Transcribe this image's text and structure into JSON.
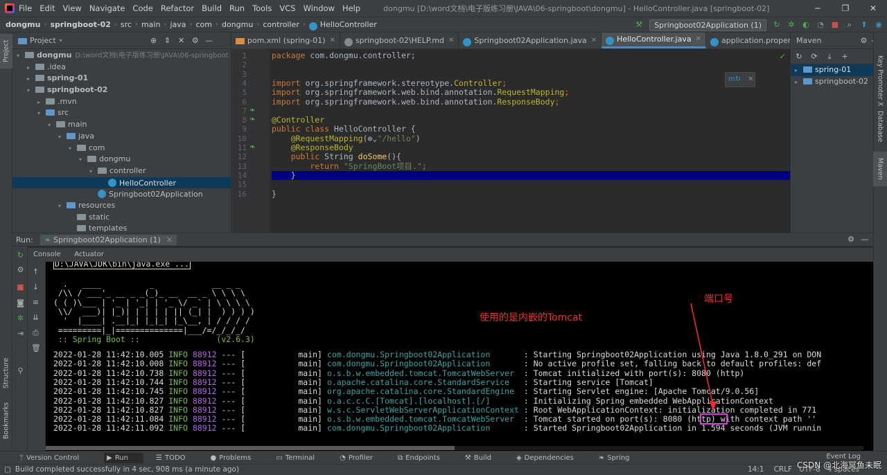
{
  "titlebar": {
    "menu": [
      "File",
      "Edit",
      "View",
      "Navigate",
      "Code",
      "Refactor",
      "Build",
      "Run",
      "Tools",
      "VCS",
      "Window",
      "Help"
    ],
    "title": "dongmu [D:\\word文档\\电子版练习册\\JAVA\\06-springboot\\dongmu] - HelloController.java [springboot-02]"
  },
  "breadcrumb": [
    "dongmu",
    "springboot-02",
    "src",
    "main",
    "java",
    "com",
    "dongmu",
    "controller",
    "HelloController"
  ],
  "run_config": "Springboot02Application (1)",
  "project": {
    "header": "Project",
    "items": [
      {
        "label": "dongmu",
        "extra": "D:\\word文档\\电子版练习册\\JAVA\\06-springboot",
        "depth": 0,
        "arrow": "▾",
        "bold": true
      },
      {
        "label": ".idea",
        "depth": 1,
        "arrow": "▸"
      },
      {
        "label": "spring-01",
        "depth": 1,
        "arrow": "▸",
        "bold": true
      },
      {
        "label": "springboot-02",
        "depth": 1,
        "arrow": "▾",
        "bold": true
      },
      {
        "label": ".mvn",
        "depth": 2,
        "arrow": "▸"
      },
      {
        "label": "src",
        "depth": 2,
        "arrow": "▾"
      },
      {
        "label": "main",
        "depth": 3,
        "arrow": "▾"
      },
      {
        "label": "java",
        "depth": 4,
        "arrow": "▾"
      },
      {
        "label": "com",
        "depth": 5,
        "arrow": "▾"
      },
      {
        "label": "dongmu",
        "depth": 6,
        "arrow": "▾"
      },
      {
        "label": "controller",
        "depth": 7,
        "arrow": "▾"
      },
      {
        "label": "HelloController",
        "depth": 8,
        "arrow": "",
        "selected": true,
        "cls": true
      },
      {
        "label": "Springboot02Application",
        "depth": 7,
        "arrow": "",
        "cls": true
      },
      {
        "label": "resources",
        "depth": 4,
        "arrow": "▾"
      },
      {
        "label": "static",
        "depth": 5,
        "arrow": ""
      },
      {
        "label": "templates",
        "depth": 5,
        "arrow": ""
      }
    ]
  },
  "editor_tabs": [
    {
      "label": "pom.xml (spring-01)"
    },
    {
      "label": "springboot-02\\HELP.md"
    },
    {
      "label": "Springboot02Application.java"
    },
    {
      "label": "HelloController.java",
      "active": true
    },
    {
      "label": "application.propertie"
    }
  ],
  "code_lines": [
    [
      {
        "t": "package ",
        "c": "kw"
      },
      {
        "t": "com.dongmu.controller;",
        "c": ""
      }
    ],
    [],
    [],
    [
      {
        "t": "import ",
        "c": "kw"
      },
      {
        "t": "org.springframework.stereotype.",
        "c": ""
      },
      {
        "t": "Controller",
        "c": "an"
      },
      {
        "t": ";",
        "c": "kw"
      }
    ],
    [
      {
        "t": "import ",
        "c": "kw"
      },
      {
        "t": "org.springframework.web.bind.annotation.",
        "c": ""
      },
      {
        "t": "RequestMapping",
        "c": "an"
      },
      {
        "t": ";",
        "c": "kw"
      }
    ],
    [
      {
        "t": "import ",
        "c": "kw"
      },
      {
        "t": "org.springframework.web.bind.annotation.",
        "c": ""
      },
      {
        "t": "ResponseBody",
        "c": "an"
      },
      {
        "t": ";",
        "c": "kw"
      }
    ],
    [],
    [
      {
        "t": "@Controller",
        "c": "an"
      }
    ],
    [
      {
        "t": "public class ",
        "c": "kw"
      },
      {
        "t": "HelloController {",
        "c": ""
      }
    ],
    [
      {
        "t": "    @RequestMapping",
        "c": "an"
      },
      {
        "t": "(",
        "c": ""
      },
      {
        "t": "⊕⌄",
        "c": ""
      },
      {
        "t": "\"/hello\"",
        "c": "st"
      },
      {
        "t": ")",
        "c": ""
      }
    ],
    [
      {
        "t": "    @ResponseBody",
        "c": "an"
      }
    ],
    [
      {
        "t": "    public ",
        "c": "kw"
      },
      {
        "t": "String ",
        "c": ""
      },
      {
        "t": "doSome",
        "c": "fn"
      },
      {
        "t": "(){",
        "c": ""
      }
    ],
    [
      {
        "t": "        return ",
        "c": "kw"
      },
      {
        "t": "\"SpringBoot项目.\"",
        "c": "st"
      },
      {
        "t": ";",
        "c": "kw"
      }
    ],
    [
      {
        "t": "    }",
        "c": ""
      }
    ],
    [],
    [
      {
        "t": "}",
        "c": ""
      }
    ],
    []
  ],
  "maven": {
    "header": "Maven",
    "items": [
      "spring-01",
      "springboot-02"
    ]
  },
  "run": {
    "label": "Run:",
    "config": "Springboot02Application (1)",
    "subtabs": [
      "Console",
      "Actuator"
    ]
  },
  "console": {
    "cmd": "D:\\JAVA\\JDK\\bin\\java.exe ...",
    "banner": [
      "  .   ____          _            __ _ _",
      " /\\\\ / ___'_ __ _ _(_)_ __  __ _ \\ \\ \\ \\",
      "( ( )\\___ | '_ | '_| | '_ \\/ _` | \\ \\ \\ \\",
      " \\\\/  ___)| |_)| | | | | || (_| |  ) ) ) )",
      "  '  |____| .__|_| |_|_| |_\\__, | / / / /",
      " =========|_|==============|___/=/_/_/_/"
    ],
    "banner_footer": " :: Spring Boot ::                (v2.6.3)",
    "logs": [
      {
        "time": "2022-01-28 11:42:10.005",
        "level": "INFO",
        "pid": "88912",
        "sep": "--- [",
        "thread": "           main]",
        "logger": "com.dongmu.Springboot02Application      ",
        "msg": " : Starting Springboot02Application using Java 1.8.0_291 on DON"
      },
      {
        "time": "2022-01-28 11:42:10.008",
        "level": "INFO",
        "pid": "88912",
        "sep": "--- [",
        "thread": "           main]",
        "logger": "com.dongmu.Springboot02Application      ",
        "msg": " : No active profile set, falling back to default profiles: def"
      },
      {
        "time": "2022-01-28 11:42:10.738",
        "level": "INFO",
        "pid": "88912",
        "sep": "--- [",
        "thread": "           main]",
        "logger": "o.s.b.w.embedded.tomcat.TomcatWebServer ",
        "msg": " : Tomcat initialized with port(s): 8080 (http)"
      },
      {
        "time": "2022-01-28 11:42:10.744",
        "level": "INFO",
        "pid": "88912",
        "sep": "--- [",
        "thread": "           main]",
        "logger": "o.apache.catalina.core.StandardService  ",
        "msg": " : Starting service [Tomcat]"
      },
      {
        "time": "2022-01-28 11:42:10.745",
        "level": "INFO",
        "pid": "88912",
        "sep": "--- [",
        "thread": "           main]",
        "logger": "org.apache.catalina.core.StandardEngine ",
        "msg": " : Starting Servlet engine: [Apache Tomcat/9.0.56]"
      },
      {
        "time": "2022-01-28 11:42:10.827",
        "level": "INFO",
        "pid": "88912",
        "sep": "--- [",
        "thread": "           main]",
        "logger": "o.a.c.c.C.[Tomcat].[localhost].[/]      ",
        "msg": " : Initializing Spring embedded WebApplicationContext"
      },
      {
        "time": "2022-01-28 11:42:10.827",
        "level": "INFO",
        "pid": "88912",
        "sep": "--- [",
        "thread": "           main]",
        "logger": "w.s.c.ServletWebServerApplicationContext",
        "msg": " : Root WebApplicationContext: initialization completed in 771"
      },
      {
        "time": "2022-01-28 11:42:11.084",
        "level": "INFO",
        "pid": "88912",
        "sep": "--- [",
        "thread": "           main]",
        "logger": "o.s.b.w.embedded.tomcat.TomcatWebServer ",
        "msg": " : Tomcat started on port(s): 8080 (http) with context path ''"
      },
      {
        "time": "2022-01-28 11:42:11.092",
        "level": "INFO",
        "pid": "88912",
        "sep": "--- [",
        "thread": "           main]",
        "logger": "com.dongmu.Springboot02Application      ",
        "msg": " : Started Springboot02Application in 1.594 seconds (JVM runnin"
      }
    ],
    "annotation_tomcat": "使用的是内嵌的Tomcat",
    "annotation_port": "端口号"
  },
  "bottom_tabs": [
    "Version Control",
    "Run",
    "TODO",
    "Problems",
    "Terminal",
    "Profiler",
    "Endpoints",
    "Build",
    "Dependencies",
    "Spring"
  ],
  "event_log": "Event Log",
  "status": {
    "message": "Build completed successfully in 4 sec, 908 ms (a minute ago)",
    "position": "14:1",
    "lf": "CRLF",
    "encoding": "UTF-8",
    "indent": "4 spaces"
  },
  "watermark": "CSDN @北海冥鱼未眠",
  "left_tabs": [
    "Project",
    "Structure",
    "Bookmarks"
  ],
  "right_tabs": [
    "Key Promoter X",
    "Database",
    "Maven"
  ],
  "line_numbers": [
    "1",
    "2",
    "3",
    "4",
    "5",
    "6",
    "7",
    "8",
    "9",
    "10",
    "11",
    "12",
    "13",
    "14",
    "15",
    "16"
  ]
}
